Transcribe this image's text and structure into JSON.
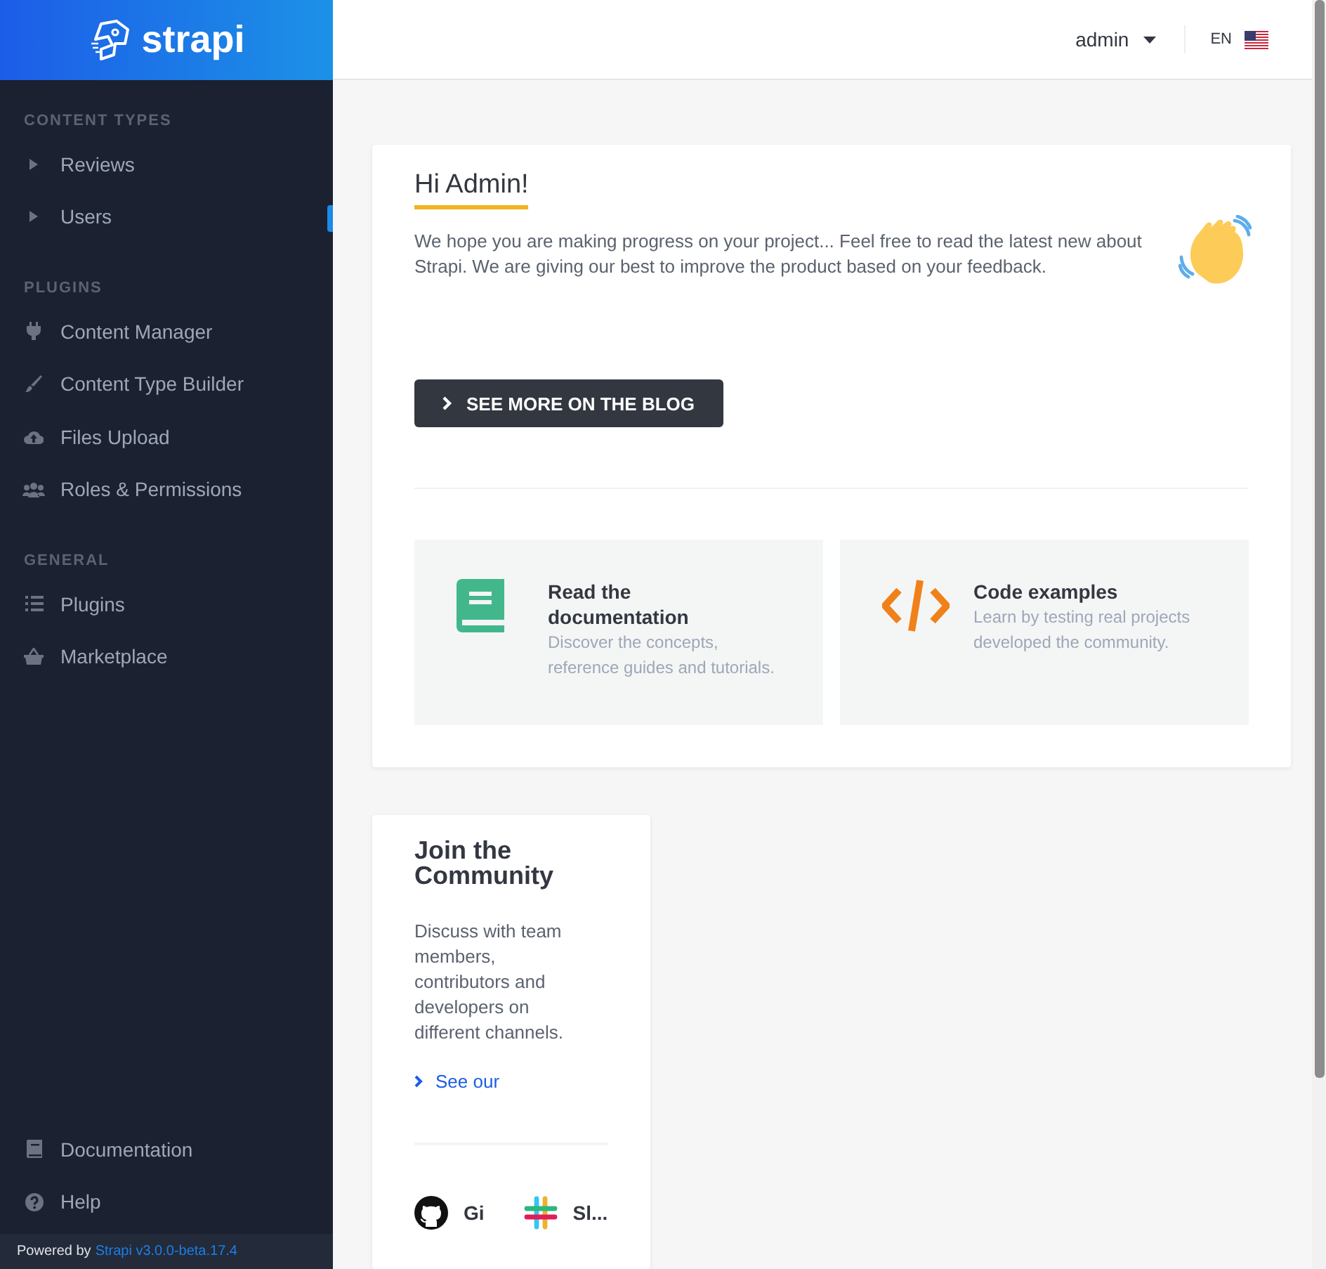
{
  "brand": {
    "name": "strapi"
  },
  "header": {
    "user": "admin",
    "language": "EN"
  },
  "sidebar": {
    "sections": [
      {
        "title": "CONTENT TYPES",
        "items": [
          {
            "label": "Reviews",
            "kind": "caret"
          },
          {
            "label": "Users",
            "kind": "caret"
          }
        ]
      },
      {
        "title": "PLUGINS",
        "items": [
          {
            "label": "Content Manager",
            "kind": "plug"
          },
          {
            "label": "Content Type Builder",
            "kind": "brush"
          },
          {
            "label": "Files Upload",
            "kind": "cloud"
          },
          {
            "label": "Roles & Permissions",
            "kind": "users"
          }
        ]
      },
      {
        "title": "GENERAL",
        "items": [
          {
            "label": "Plugins",
            "kind": "list"
          },
          {
            "label": "Marketplace",
            "kind": "basket"
          }
        ]
      }
    ],
    "footer_links": [
      {
        "label": "Documentation",
        "kind": "book"
      },
      {
        "label": "Help",
        "kind": "help"
      }
    ],
    "powered_by": {
      "text": "Powered by",
      "link": "Strapi v3.0.0-beta.17.4"
    }
  },
  "welcome": {
    "title": "Hi Admin!",
    "text": "We hope you are making progress on your project... Feel free to read the latest new about Strapi. We are giving our best to improve the product based on your feedback.",
    "button": "SEE MORE ON THE BLOG",
    "tiles": [
      {
        "kind": "book",
        "title": "Read the documentation",
        "text": "Discover the concepts, reference guides and tutorials."
      },
      {
        "kind": "code",
        "title": "Code examples",
        "text": "Learn by testing real projects developed the community."
      }
    ]
  },
  "community": {
    "title": "Join the Community",
    "text": "Discuss with team members, contributors and developers on different channels.",
    "link": "See our",
    "socials": [
      {
        "kind": "github",
        "label": "Gi"
      },
      {
        "kind": "slack",
        "label": "Sl..."
      }
    ]
  }
}
